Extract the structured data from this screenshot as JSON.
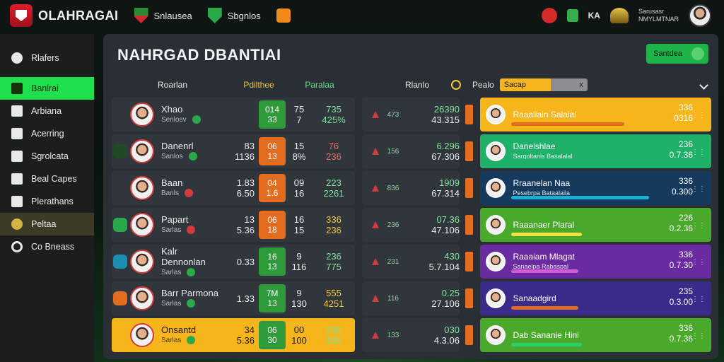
{
  "app": {
    "brand": "OLAHRAGAI"
  },
  "top_tabs": [
    {
      "label": "Snlausea",
      "icon": "shield-icon"
    },
    {
      "label": "Sbgnlos",
      "icon": "shield-icon"
    },
    {
      "label": "",
      "icon": "orange-badge-icon"
    }
  ],
  "top_right": {
    "label": "KA",
    "user_line1": "Sarusasr",
    "user_line2": "NMYLMTNAR"
  },
  "sidebar": [
    {
      "label": "Rlafers",
      "icon": "circle-icon"
    },
    {
      "label": "Banlrai",
      "icon": "calendar-icon",
      "state": "active"
    },
    {
      "label": "Arbiana",
      "icon": "arrow-icon"
    },
    {
      "label": "Acerring",
      "icon": "tag-icon"
    },
    {
      "label": "Sgrolcata",
      "icon": "chart-icon"
    },
    {
      "label": "Beal Capes",
      "icon": "screen-icon"
    },
    {
      "label": "Plerathans",
      "icon": "book-icon"
    },
    {
      "label": "Peltaa",
      "icon": "gear-icon",
      "state": "selected"
    },
    {
      "label": "Co Bneass",
      "icon": "globe-icon"
    }
  ],
  "main": {
    "title": "NAHRGAD DBANTIAI",
    "action_button": "Santdea",
    "left_headers": [
      "Roarlan",
      "Pdilthee",
      "Paralaa"
    ],
    "left_rows": [
      {
        "name": "Xhao",
        "sub": "Senlosv",
        "dot_color": "#2aa84a",
        "pill_color": "#31363d",
        "n1a": "",
        "n1b": "",
        "box_a": "014",
        "box_b": "33",
        "box_color": "g",
        "n2a": "75",
        "n2b": "7",
        "n3a": "735",
        "n3b": "425%",
        "n3_color": "gr"
      },
      {
        "name": "Danenrl",
        "sub": "Sanlos",
        "dot_color": "#2aa84a",
        "pill_color": "#1f4a22",
        "n1a": "83",
        "n1b": "1136",
        "box_a": "06",
        "box_b": "13",
        "box_color": "o",
        "n2a": "15",
        "n2b": "8%",
        "n3a": "76",
        "n3b": "236",
        "n3_color": "r"
      },
      {
        "name": "Baan",
        "sub": "Banls",
        "dot_color": "#d23b3b",
        "pill_color": "#31363d",
        "n1a": "1.83",
        "n1b": "6.50",
        "box_a": "04",
        "box_b": "1.6",
        "box_color": "o",
        "n2a": "09",
        "n2b": "16",
        "n3a": "223",
        "n3b": "2261",
        "n3_color": "gr"
      },
      {
        "name": "Papart",
        "sub": "Sarlas",
        "dot_color": "#d23b3b",
        "pill_color": "#2aa84a",
        "n1a": "13",
        "n1b": "5.36",
        "box_a": "06",
        "box_b": "18",
        "box_color": "o",
        "n2a": "16",
        "n2b": "15",
        "n3a": "336",
        "n3b": "236",
        "n3_color": "y"
      },
      {
        "name": "Kalr Dennonlan",
        "sub": "Sarlas",
        "dot_color": "#2aa84a",
        "pill_color": "#1a8fb0",
        "n1a": "",
        "n1b": "0.33",
        "box_a": "16",
        "box_b": "13",
        "box_color": "g",
        "n2a": "9",
        "n2b": "116",
        "n3a": "236",
        "n3b": "775",
        "n3_color": "gr"
      },
      {
        "name": "Barr Parmona",
        "sub": "Sarlas",
        "dot_color": "#2aa84a",
        "pill_color": "#e36c1e",
        "n1a": "",
        "n1b": "1.33",
        "box_a": "7M",
        "box_b": "13",
        "box_color": "g",
        "n2a": "9",
        "n2b": "130",
        "n3a": "555",
        "n3b": "4251",
        "n3_color": "y"
      },
      {
        "name": "Onsantd",
        "sub": "Sarlas",
        "dot_color": "#2aa84a",
        "pill_color": "#f5b51b",
        "n1a": "34",
        "n1b": "5.36",
        "box_a": "06",
        "box_b": "30",
        "box_color": "g",
        "n2a": "00",
        "n2b": "100",
        "n3a": "230",
        "n3b": "335",
        "n3_color": "gr",
        "highlight": true
      }
    ],
    "right_headers": {
      "col_a": "Rlanlo",
      "col_b": "Pealo",
      "filter": "Sacap",
      "filter_clear": "x"
    },
    "right_rows": [
      {
        "s1": "473",
        "top": "26390",
        "bottom": "43.315",
        "card_title": "Raaaliain Salaial",
        "card_sub": "",
        "card_color": "#f5b51b",
        "bar_color": "#e36c1e",
        "bar_pct": 64,
        "num_top": "336",
        "num_bottom": "0316"
      },
      {
        "s1": "156",
        "top": "6.296",
        "bottom": "67.306",
        "card_title": "Danelshlae",
        "card_sub": "Sargoltanls Basalalal",
        "card_color": "#1fb06a",
        "bar_color": "#1fb06a",
        "bar_pct": 40,
        "num_top": "236",
        "num_bottom": "0.7.36"
      },
      {
        "s1": "836",
        "top": "1909",
        "bottom": "67.314",
        "card_title": "Rraanelan Naa",
        "card_sub": "Pesebrpa Bataalaila",
        "card_color": "#153a5e",
        "bar_color": "#1ab0d6",
        "bar_pct": 78,
        "num_top": "336",
        "num_bottom": "0.300"
      },
      {
        "s1": "236",
        "top": "07.36",
        "bottom": "47.106",
        "card_title": "Raaanaer Plaral",
        "card_sub": "",
        "card_color": "#4aa82a",
        "bar_color": "#f5e042",
        "bar_pct": 40,
        "num_top": "226",
        "num_bottom": "0.2.36"
      },
      {
        "s1": "231",
        "top": "430",
        "bottom": "5.7.104",
        "card_title": "Raaaiam Mlagat",
        "card_sub": "Sanaelpa Rabaspal",
        "card_color": "#6a2aa0",
        "bar_color": "#d45ad6",
        "bar_pct": 38,
        "num_top": "336",
        "num_bottom": "0.7.30"
      },
      {
        "s1": "116",
        "top": "0.25",
        "bottom": "27.106",
        "card_title": "Sanaadgird",
        "card_sub": "",
        "card_color": "#3a2a8a",
        "bar_color": "#e36c1e",
        "bar_pct": 38,
        "num_top": "235",
        "num_bottom": "0.3.00"
      },
      {
        "s1": "133",
        "top": "030",
        "bottom": "4.3.06",
        "card_title": "Dab Sananie Hini",
        "card_sub": "",
        "card_color": "#4aa82a",
        "bar_color": "#2ad06a",
        "bar_pct": 40,
        "num_top": "336",
        "num_bottom": "0.7.36"
      }
    ]
  }
}
